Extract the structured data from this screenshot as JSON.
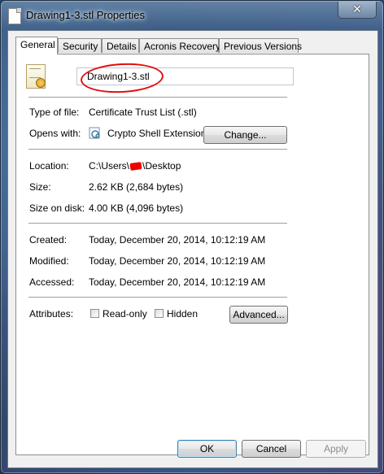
{
  "window": {
    "title": "Drawing1-3.stl Properties",
    "close_glyph": "✕"
  },
  "tabs": [
    {
      "label": "General",
      "active": true
    },
    {
      "label": "Security"
    },
    {
      "label": "Details"
    },
    {
      "label": "Acronis Recovery"
    },
    {
      "label": "Previous Versions"
    }
  ],
  "general": {
    "file_icon": "certificate-icon",
    "filename": "Drawing1-3.stl",
    "type_label": "Type of file:",
    "type_value": "Certificate Trust List (.stl)",
    "opens_label": "Opens with:",
    "opens_value": "Crypto Shell Extensions",
    "opens_icon": "crypto-shell-icon",
    "change_button": "Change...",
    "location_label": "Location:",
    "location_prefix": "C:\\Users\\",
    "location_suffix": "\\Desktop",
    "size_label": "Size:",
    "size_value": "2.62 KB (2,684 bytes)",
    "size_on_disk_label": "Size on disk:",
    "size_on_disk_value": "4.00 KB (4,096 bytes)",
    "created_label": "Created:",
    "created_value": "Today, December 20, 2014, 10:12:19 AM",
    "modified_label": "Modified:",
    "modified_value": "Today, December 20, 2014, 10:12:19 AM",
    "accessed_label": "Accessed:",
    "accessed_value": "Today, December 20, 2014, 10:12:19 AM",
    "attributes_label": "Attributes:",
    "readonly_label": "Read-only",
    "readonly_checked": false,
    "hidden_label": "Hidden",
    "hidden_checked": false,
    "advanced_button": "Advanced..."
  },
  "footer": {
    "ok": "OK",
    "cancel": "Cancel",
    "apply": "Apply"
  },
  "colors": {
    "annotation_red": "#e01010",
    "default_button_border": "#3c7fb1"
  }
}
